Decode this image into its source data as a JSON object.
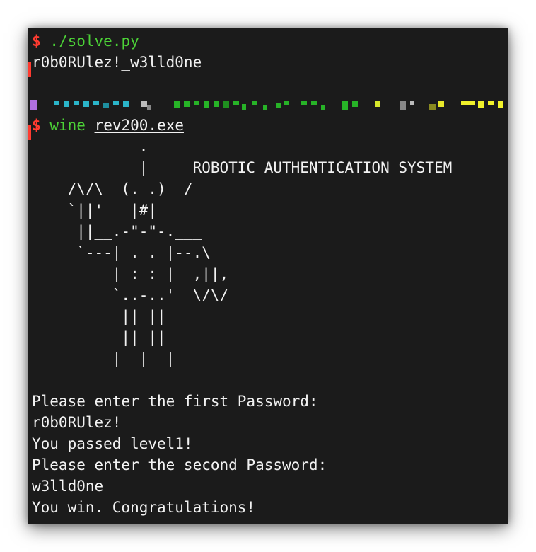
{
  "terminal": {
    "lines": {
      "prompt1": "$",
      "cmd1": "./solve.py",
      "output1": "r0b0RUlez!_w3lld0ne",
      "prompt2": "$",
      "cmd2_program": "wine",
      "cmd2_arg": "rev200.exe",
      "ascii_art": "            .\n           _|_    ROBOTIC AUTHENTICATION SYSTEM\n    /\\/\\  (. .)  /\n    `||'   |#|\n     ||__.-\"-\"-.___\n     `---| . . |--.\\\n         | : : |  ,||,\n         `..-..'  \\/\\/\n          || ||\n          || ||\n         |__|__|",
      "blank": "",
      "prompt_first": "Please enter the first Password:",
      "input_first": "r0b0RUlez!",
      "result_first": "You passed level1!",
      "prompt_second": "Please enter the second Password:",
      "input_second": "w3lld0ne",
      "result_final": "You win. Congratulations!"
    },
    "colors": {
      "background": "#1b1b1b",
      "text": "#f2f2f2",
      "prompt": "#ff3b30",
      "command": "#4cd137"
    }
  }
}
